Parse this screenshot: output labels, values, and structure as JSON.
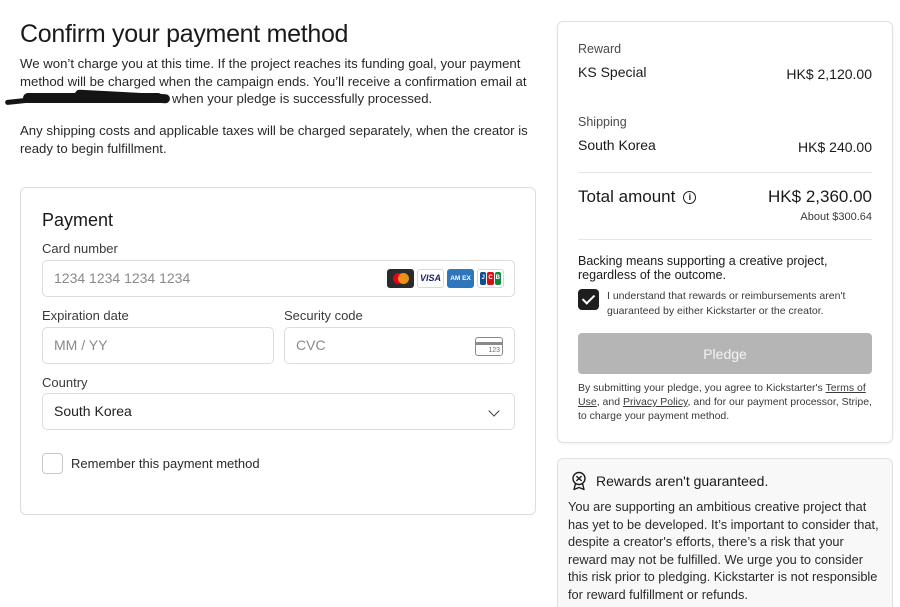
{
  "page": {
    "title": "Confirm your payment method",
    "intro_part1": "We won’t charge you at this time. If the project reaches its funding goal, your payment method will be charged when the campaign ends. You’ll receive a confirmation email at",
    "intro_part2": "when your pledge is successfully processed.",
    "intro_second": "Any shipping costs and applicable taxes will be charged separately, when the creator is ready to begin fulfillment."
  },
  "payment": {
    "heading": "Payment",
    "card_number_label": "Card number",
    "card_number_placeholder": "1234 1234 1234 1234",
    "card_brands": [
      "mastercard",
      "visa",
      "amex",
      "jcb"
    ],
    "brand_visa": "VISA",
    "brand_amex": "AM EX",
    "brand_jcb": [
      "J",
      "C",
      "B"
    ],
    "expiration_label": "Expiration date",
    "expiration_placeholder": "MM / YY",
    "security_label": "Security code",
    "security_placeholder": "CVC",
    "cvc_icon_number": "123",
    "country_label": "Country",
    "country_value": "South Korea",
    "remember_label": "Remember this payment method"
  },
  "summary": {
    "reward_label": "Reward",
    "reward_name": "KS Special",
    "reward_amount": "HK$ 2,120.00",
    "shipping_label": "Shipping",
    "shipping_destination": "South Korea",
    "shipping_amount": "HK$ 240.00",
    "total_label": "Total amount",
    "total_amount": "HK$ 2,360.00",
    "total_about": "About $300.64",
    "backing_text": "Backing means supporting a creative project, regardless of the outcome.",
    "agree_text": "I understand that rewards or reimbursements aren't guaranteed by either Kickstarter or the creator.",
    "agree_checked": true,
    "pledge_button": "Pledge",
    "terms_part1": "By submitting your pledge, you agree to Kickstarter's",
    "terms_link": "Terms of Use",
    "terms_part2": ", and",
    "privacy_link": "Privacy Policy",
    "terms_part3": ", and for our payment processor, Stripe, to charge your payment method."
  },
  "warning": {
    "title": "Rewards aren't guaranteed.",
    "body": "You are supporting an ambitious creative project that has yet to be developed. It’s important to consider that, despite a creator's efforts, there’s a risk that your reward may not be fulfilled. We urge you to consider this risk prior to pledging. Kickstarter is not responsible for reward fulfillment or refunds."
  },
  "colors": {
    "pledge_disabled": "#b5b5b5",
    "checkbox_checked": "#1e1e1e",
    "amex_blue": "#2e77bc"
  }
}
